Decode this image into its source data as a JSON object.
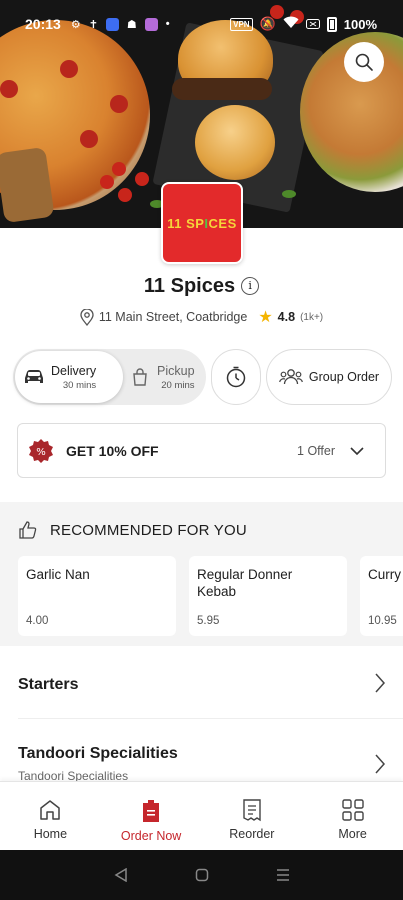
{
  "status_bar": {
    "time": "20:13",
    "vpn": "VPN",
    "battery": "100%"
  },
  "restaurant": {
    "logo_text_1": "11",
    "logo_text_2": "SP",
    "logo_text_3": "I",
    "logo_text_4": "CES",
    "name": "11 Spices",
    "info_glyph": "i",
    "address": "11 Main Street, Coatbridge",
    "rating": "4.8",
    "rating_count": "(1k+)"
  },
  "order_modes": {
    "delivery": {
      "label": "Delivery",
      "time": "30 mins",
      "selected": true
    },
    "pickup": {
      "label": "Pickup",
      "time": "20 mins",
      "selected": false
    }
  },
  "group_order_label": "Group Order",
  "offer": {
    "label": "GET 10% OFF",
    "count": "1 Offer",
    "badge_glyph": "%"
  },
  "recommended": {
    "title": "RECOMMENDED FOR YOU",
    "items": [
      {
        "name": "Garlic Nan",
        "price": "4.00"
      },
      {
        "name": "Regular Donner Kebab",
        "price": "5.95"
      },
      {
        "name": "Curry",
        "price": "10.95"
      }
    ]
  },
  "categories": [
    {
      "title": "Starters",
      "subtitle": ""
    },
    {
      "title": "Tandoori Specialities",
      "subtitle": "Tandoori Specialities"
    }
  ],
  "bottom_nav": [
    {
      "label": "Home",
      "icon": "home-icon",
      "active": false
    },
    {
      "label": "Order Now",
      "icon": "order-icon",
      "active": true
    },
    {
      "label": "Reorder",
      "icon": "receipt-icon",
      "active": false
    },
    {
      "label": "More",
      "icon": "grid-icon",
      "active": false
    }
  ],
  "colors": {
    "brand_red": "#c5262c",
    "logo_red": "#e32a2b",
    "star": "#f4b400"
  }
}
